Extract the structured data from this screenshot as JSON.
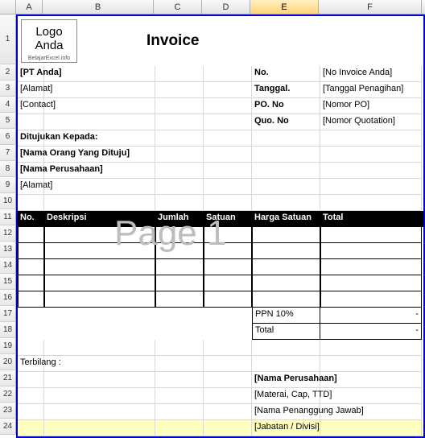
{
  "columns": [
    "A",
    "B",
    "C",
    "D",
    "E",
    "F"
  ],
  "activeColumn": "E",
  "rows": [
    "1",
    "2",
    "3",
    "4",
    "5",
    "6",
    "7",
    "8",
    "9",
    "10",
    "11",
    "12",
    "13",
    "14",
    "15",
    "16",
    "17",
    "18",
    "19",
    "20",
    "21",
    "22",
    "23",
    "24"
  ],
  "logo": {
    "line1": "Logo",
    "line2": "Anda",
    "sub": "BelajarExcel.info"
  },
  "title": "Invoice",
  "company": {
    "name": "[PT Anda]",
    "address": "[Alamat]",
    "contact": "[Contact]"
  },
  "meta": {
    "noLabel": "No.",
    "noVal": "[No Invoice Anda]",
    "dateLabel": "Tanggal.",
    "dateVal": "[Tanggal Penagihan]",
    "poLabel": "PO. No",
    "poVal": "[Nomor PO]",
    "quoLabel": "Quo. No",
    "quoVal": "[Nomor Quotation]"
  },
  "addressed": {
    "heading": "Ditujukan Kepada:",
    "person": "[Nama Orang Yang Dituju]",
    "company": "[Nama Perusahaan]",
    "address": "[Alamat]"
  },
  "table": {
    "headers": {
      "no": "No.",
      "desc": "Deskripsi",
      "qty": "Jumlah",
      "unit": "Satuan",
      "price": "Harga Satuan",
      "total": "Total"
    }
  },
  "summary": {
    "ppnLabel": "PPN 10%",
    "ppnVal": "-",
    "totalLabel": "Total",
    "totalVal": "-"
  },
  "terbilang": "Terbilang :",
  "signature": {
    "company": "[Nama Perusahaan]",
    "stamp": "[Materai, Cap, TTD]",
    "name": "[Nama Penanggung Jawab]",
    "title": "[Jabatan / Divisi]"
  },
  "watermark": "Page 1"
}
